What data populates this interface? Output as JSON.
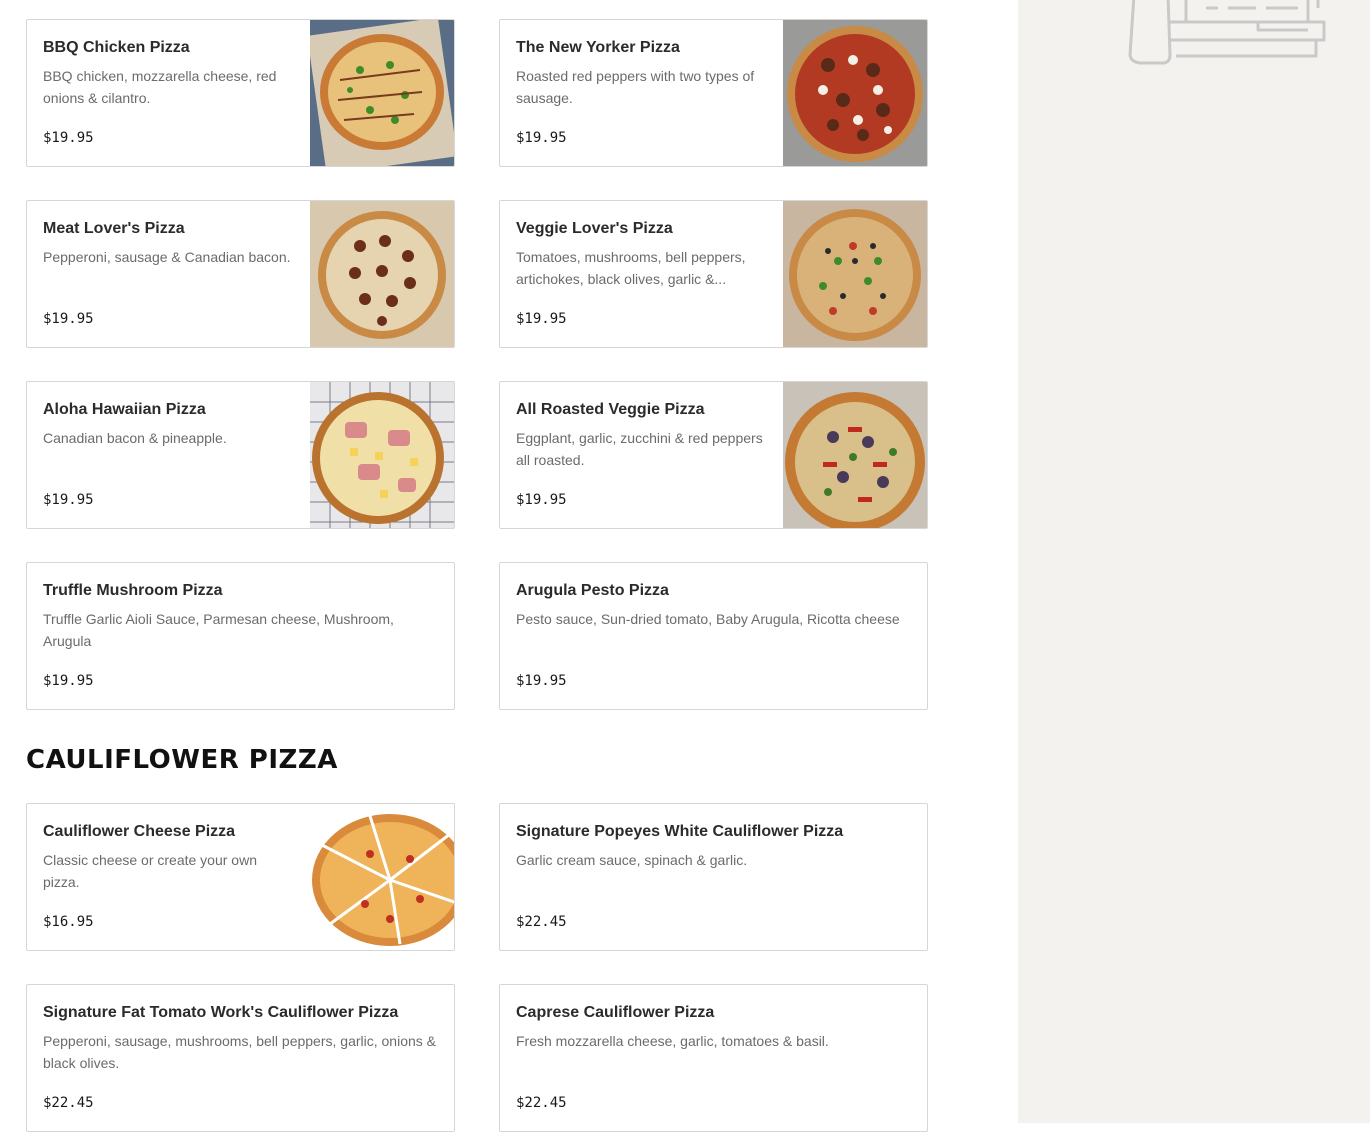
{
  "sections": [
    {
      "items": [
        {
          "name": "BBQ Chicken Pizza",
          "desc": "BBQ chicken, mozzarella cheese, red onions & cilantro.",
          "price": "$19.95",
          "image": "pizza-photo"
        },
        {
          "name": "The New Yorker Pizza",
          "desc": "Roasted red peppers with two types of sausage.",
          "price": "$19.95",
          "image": "pizza-photo"
        },
        {
          "name": "Meat Lover's Pizza",
          "desc": "Pepperoni, sausage & Canadian bacon.",
          "price": "$19.95",
          "image": "pizza-photo"
        },
        {
          "name": "Veggie Lover's Pizza",
          "desc": "Tomatoes, mushrooms, bell peppers, artichokes, black olives, garlic &...",
          "price": "$19.95",
          "image": "pizza-photo"
        },
        {
          "name": "Aloha Hawaiian Pizza",
          "desc": "Canadian bacon & pineapple.",
          "price": "$19.95",
          "image": "pizza-photo"
        },
        {
          "name": "All Roasted Veggie Pizza",
          "desc": "Eggplant, garlic, zucchini & red peppers all roasted.",
          "price": "$19.95",
          "image": "pizza-photo"
        },
        {
          "name": "Truffle Mushroom Pizza",
          "desc": "Truffle Garlic Aioli Sauce, Parmesan cheese, Mushroom, Arugula",
          "price": "$19.95"
        },
        {
          "name": "Arugula Pesto Pizza",
          "desc": "Pesto sauce, Sun-dried tomato, Baby Arugula, Ricotta cheese",
          "price": "$19.95"
        }
      ]
    },
    {
      "title": "CAULIFLOWER PIZZA",
      "items": [
        {
          "name": "Cauliflower Cheese Pizza",
          "desc": "Classic cheese or create your own pizza.",
          "price": "$16.95",
          "image": "pizza-photo"
        },
        {
          "name": "Signature Popeyes White Cauliflower Pizza",
          "desc": "Garlic cream sauce, spinach & garlic.",
          "price": "$22.45"
        },
        {
          "name": "Signature Fat Tomato Work's Cauliflower Pizza",
          "desc": "Pepperoni, sausage, mushrooms, bell peppers, garlic, onions & black olives.",
          "price": "$22.45"
        },
        {
          "name": "Caprese Cauliflower Pizza",
          "desc": "Fresh mozzarella cheese, garlic, tomatoes & basil.",
          "price": "$22.45"
        }
      ]
    }
  ],
  "sidebar": {
    "illustration": "bag-illustration-icon"
  },
  "colors": {
    "sidebar_bg": "#f3f2ef",
    "card_border": "#d6d6d6",
    "text_muted": "#6b6b6b"
  }
}
